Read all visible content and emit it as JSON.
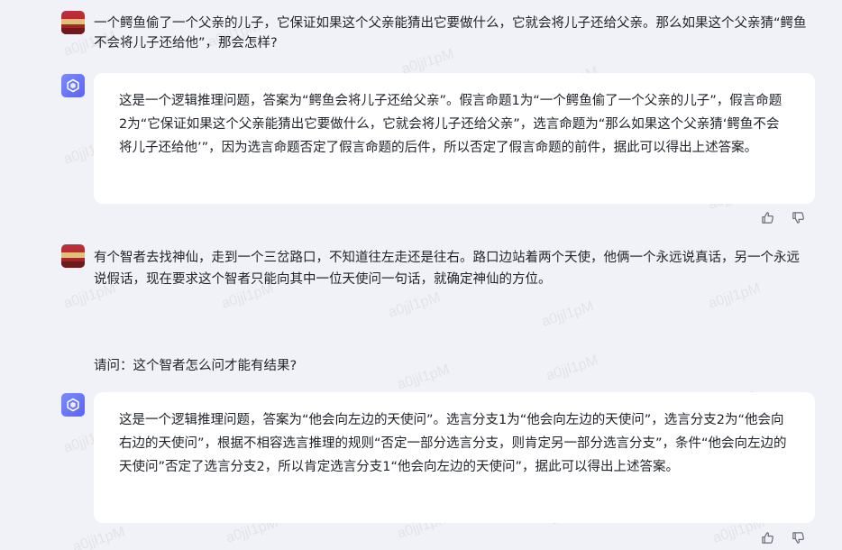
{
  "watermark_text": "a0jjl1pM",
  "messages": [
    {
      "role": "user",
      "text": "一个鳄鱼偷了一个父亲的儿子，它保证如果这个父亲能猜出它要做什么，它就会将儿子还给父亲。那么如果这个父亲猜“鳄鱼不会将儿子还给他”，那会怎样?"
    },
    {
      "role": "assistant",
      "text": "这是一个逻辑推理问题，答案为“鳄鱼会将儿子还给父亲”。假言命题1为“一个鳄鱼偷了一个父亲的儿子”，假言命题2为“它保证如果这个父亲能猜出它要做什么，它就会将儿子还给父亲”，选言命题为“那么如果这个父亲猜‘鳄鱼不会将儿子还给他’”，因为选言命题否定了假言命题的后件，所以否定了假言命题的前件，据此可以得出上述答案。"
    },
    {
      "role": "user",
      "text": "有个智者去找神仙，走到一个三岔路口，不知道往左走还是往右。路口边站着两个天使，他俩一个永远说真话，另一个永远说假话，现在要求这个智者只能向其中一位天使问一句话，就确定神仙的方位。",
      "followup": "请问：这个智者怎么问才能有结果?"
    },
    {
      "role": "assistant",
      "text": "这是一个逻辑推理问题，答案为“他会向左边的天使问”。选言分支1为“他会向左边的天使问”，选言分支2为“他会向右边的天使问”，根据不相容选言推理的规则“否定一部分选言分支，则肯定另一部分选言分支”，条件“他会向左边的天使问”否定了选言分支2，所以肯定选言分支1“他会向左边的天使问”，据此可以得出上述答案。"
    }
  ],
  "icons": {
    "like": "thumbs-up-icon",
    "dislike": "thumbs-down-icon",
    "ai_logo": "cube-logo-icon"
  },
  "colors": {
    "background": "#f1f2f7",
    "bubble": "#ffffff",
    "accent": "#6b74f5"
  }
}
